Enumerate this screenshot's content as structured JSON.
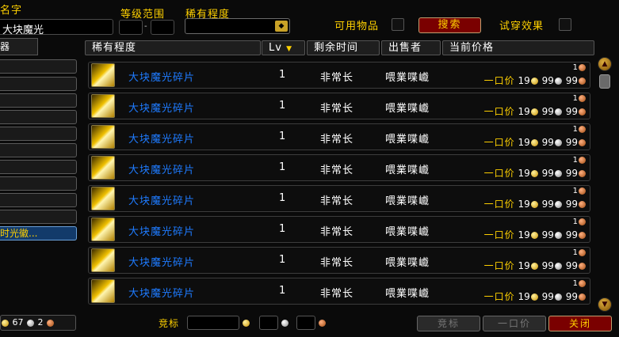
{
  "search": {
    "name_label": "名字",
    "name_value": "大块魔光",
    "level_label": "等级范围",
    "level_sep": "-",
    "rarity_label": "稀有程度",
    "usable_label": "可用物品",
    "search_button": "搜索",
    "preview_label": "试穿效果"
  },
  "categories": {
    "tab_label": "器",
    "selected_label": "时光徽..."
  },
  "columns": [
    "稀有程度",
    "Lv",
    "剩余时间",
    "出售者",
    "当前价格"
  ],
  "items": [
    {
      "name": "大块魔光碎片",
      "lv": "1",
      "time": "非常长",
      "seller": "喂業喋巇",
      "bid": "1",
      "buyout_tag": "一口价",
      "gold": "19",
      "silver": "99",
      "copper": "99"
    },
    {
      "name": "大块魔光碎片",
      "lv": "1",
      "time": "非常长",
      "seller": "喂業喋巇",
      "bid": "1",
      "buyout_tag": "一口价",
      "gold": "19",
      "silver": "99",
      "copper": "99"
    },
    {
      "name": "大块魔光碎片",
      "lv": "1",
      "time": "非常长",
      "seller": "喂業喋巇",
      "bid": "1",
      "buyout_tag": "一口价",
      "gold": "19",
      "silver": "99",
      "copper": "99"
    },
    {
      "name": "大块魔光碎片",
      "lv": "1",
      "time": "非常长",
      "seller": "喂業喋巇",
      "bid": "1",
      "buyout_tag": "一口价",
      "gold": "19",
      "silver": "99",
      "copper": "99"
    },
    {
      "name": "大块魔光碎片",
      "lv": "1",
      "time": "非常长",
      "seller": "喂業喋巇",
      "bid": "1",
      "buyout_tag": "一口价",
      "gold": "19",
      "silver": "99",
      "copper": "99"
    },
    {
      "name": "大块魔光碎片",
      "lv": "1",
      "time": "非常长",
      "seller": "喂業喋巇",
      "bid": "1",
      "buyout_tag": "一口价",
      "gold": "19",
      "silver": "99",
      "copper": "99"
    },
    {
      "name": "大块魔光碎片",
      "lv": "1",
      "time": "非常长",
      "seller": "喂業喋巇",
      "bid": "1",
      "buyout_tag": "一口价",
      "gold": "19",
      "silver": "99",
      "copper": "99"
    },
    {
      "name": "大块魔光碎片",
      "lv": "1",
      "time": "非常长",
      "seller": "喂業喋巇",
      "bid": "1",
      "buyout_tag": "一口价",
      "gold": "19",
      "silver": "99",
      "copper": "99"
    }
  ],
  "footer": {
    "money_silver": "67",
    "money_copper": "2",
    "bid_label": "竞标",
    "bid_button": "竞标",
    "buyout_button": "一口价",
    "close_button": "关闭"
  },
  "colors": {
    "gold_text": "#ffd100",
    "item_rare": "#1e7bff",
    "accent_red": "#7a0000"
  }
}
